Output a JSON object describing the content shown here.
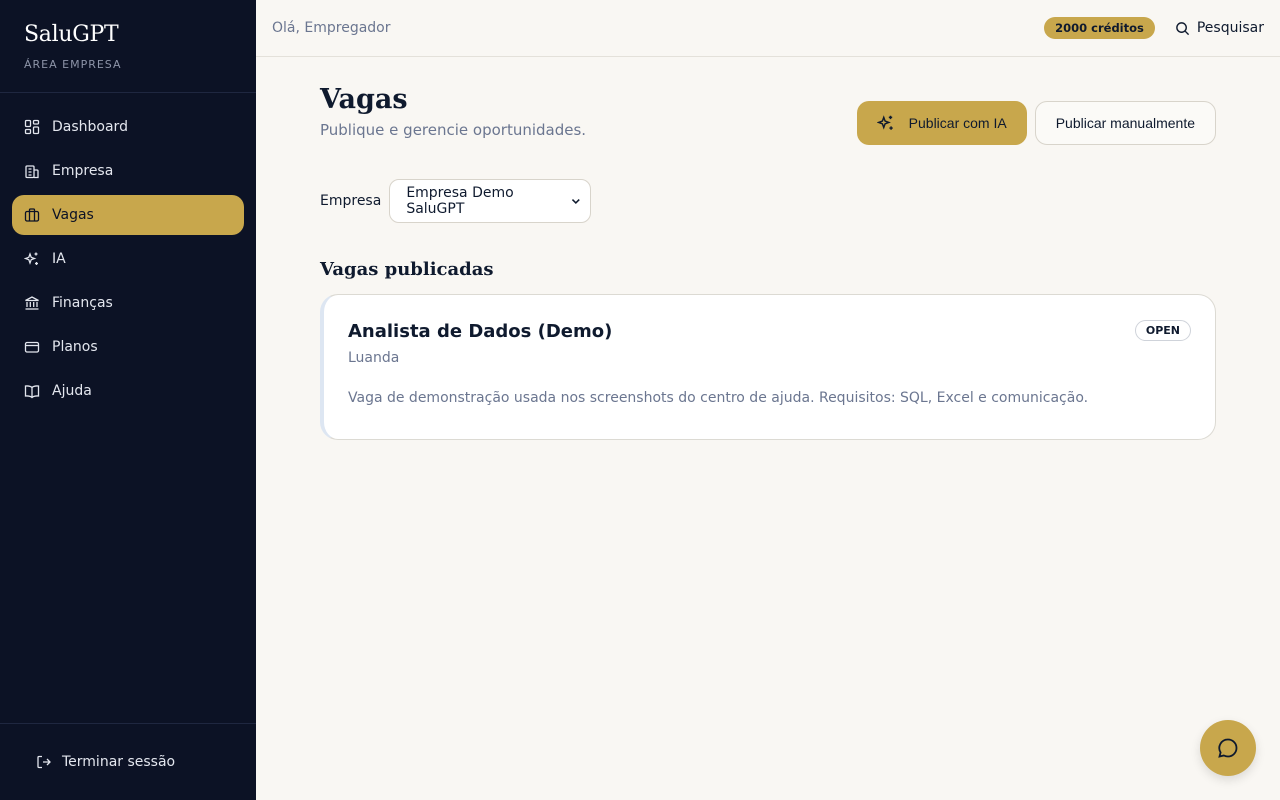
{
  "brand": {
    "title": "SaluGPT",
    "subtitle": "ÁREA EMPRESA"
  },
  "sidebar": {
    "items": [
      {
        "label": "Dashboard",
        "icon": "dashboard-icon"
      },
      {
        "label": "Empresa",
        "icon": "building-icon"
      },
      {
        "label": "Vagas",
        "icon": "briefcase-icon",
        "active": true
      },
      {
        "label": "IA",
        "icon": "sparkles-icon"
      },
      {
        "label": "Finanças",
        "icon": "bank-icon"
      },
      {
        "label": "Planos",
        "icon": "credit-card-icon"
      },
      {
        "label": "Ajuda",
        "icon": "book-icon"
      }
    ],
    "logout_label": "Terminar sessão"
  },
  "topbar": {
    "greeting": "Olá, Empregador",
    "credits": "2000 créditos",
    "search_label": "Pesquisar"
  },
  "page": {
    "title": "Vagas",
    "subtitle": "Publique e gerencie oportunidades.",
    "ai_button": "Publicar com IA",
    "manual_button": "Publicar manualmente"
  },
  "filter": {
    "label": "Empresa",
    "selected": "Empresa Demo SaluGPT"
  },
  "jobs": {
    "section_title": "Vagas publicadas",
    "items": [
      {
        "title": "Analista de Dados (Demo)",
        "location": "Luanda",
        "description": "Vaga de demonstração usada nos screenshots do centro de ajuda. Requisitos: SQL, Excel e comunicação.",
        "status": "OPEN"
      }
    ]
  },
  "colors": {
    "sidebar_bg": "#0c1225",
    "accent": "#c8a74c",
    "page_bg": "#f9f7f3"
  }
}
